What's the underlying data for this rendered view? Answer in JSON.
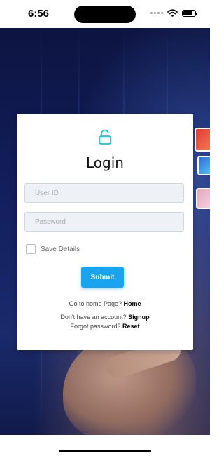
{
  "status_bar": {
    "time": "6:56",
    "battery_level": 0.8
  },
  "login": {
    "icon": "unlock-icon",
    "accent_color": "#1aa3ef",
    "title": "Login",
    "userid_placeholder": "User ID",
    "userid_value": "",
    "password_placeholder": "Password",
    "password_value": "",
    "save_details_label": "Save Details",
    "save_details_checked": false,
    "submit_label": "Submit",
    "home_prompt": "Go to home Page?",
    "home_link": "Home",
    "signup_prompt": "Don't have an account?",
    "signup_link": "Signup",
    "reset_prompt": "Forgot password?",
    "reset_link": "Reset"
  }
}
